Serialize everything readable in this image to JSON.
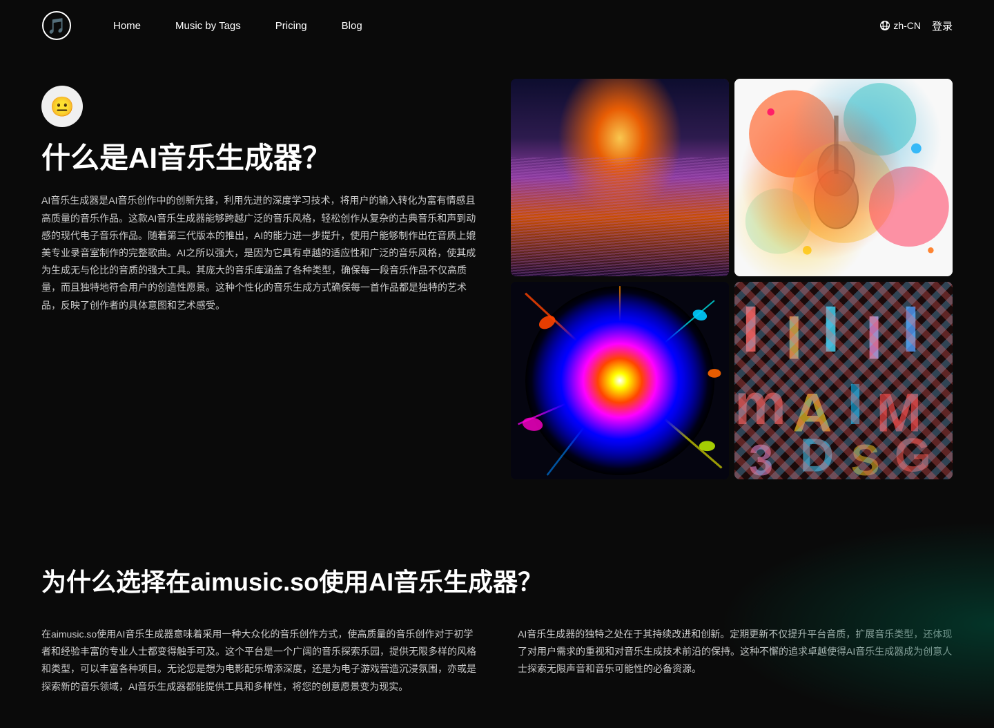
{
  "nav": {
    "logo_alt": "AI Music Logo",
    "links": [
      {
        "id": "home",
        "label": "Home"
      },
      {
        "id": "music-by-tags",
        "label": "Music by Tags"
      },
      {
        "id": "pricing",
        "label": "Pricing"
      },
      {
        "id": "blog",
        "label": "Blog"
      }
    ],
    "lang": "zh-CN",
    "login": "登录"
  },
  "hero": {
    "title": "什么是AI音乐生成器？",
    "description": "AI音乐生成器是AI音乐创作中的创新先锋，利用先进的深度学习技术，将用户的输入转化为富有情感且高质量的音乐作品。这款AI音乐生成器能够跨越广泛的音乐风格，轻松创作从复杂的古典音乐和声到动感的现代电子音乐作品。随着第三代版本的推出，AI的能力进一步提升，使用户能够制作出在音质上媲美专业录音室制作的完整歌曲。AI之所以强大，是因为它具有卓越的适应性和广泛的音乐风格，使其成为生成无与伦比的音质的强大工具。其庞大的音乐库涵盖了各种类型，确保每一段音乐作品不仅高质量，而且独特地符合用户的创造性愿景。这种个性化的音乐生成方式确保每一首作品都是独特的艺术品，反映了创作者的具体意图和艺术感受。",
    "images": [
      {
        "id": "img-mountain",
        "alt": "Abstract mountain landscape with moon"
      },
      {
        "id": "img-violin",
        "alt": "Colorful violin and instruments"
      },
      {
        "id": "img-explosion",
        "alt": "Colorful paint explosion"
      },
      {
        "id": "img-letters",
        "alt": "Colorful decorative letters"
      }
    ]
  },
  "why_section": {
    "title": "为什么选择在aimusic.so使用AI音乐生成器？",
    "col1": "在aimusic.so使用AI音乐生成器意味着采用一种大众化的音乐创作方式，使高质量的音乐创作对于初学者和经验丰富的专业人士都变得触手可及。这个平台是一个广阔的音乐探索乐园，提供无限多样的风格和类型，可以丰富各种项目。无论您是想为电影配乐增添深度，还是为电子游戏营造沉浸氛围，亦或是探索新的音乐领域，AI音乐生成器都能提供工具和多样性，将您的创意愿景变为现实。",
    "col2": "AI音乐生成器的独特之处在于其持续改进和创新。定期更新不仅提升平台音质，扩展音乐类型，还体现了对用户需求的重视和对音乐生成技术前沿的保持。这种不懈的追求卓越使得AI音乐生成器成为创意人士探索无限声音和音乐可能性的必备资源。"
  },
  "avatar": {
    "emoji": "😐"
  }
}
